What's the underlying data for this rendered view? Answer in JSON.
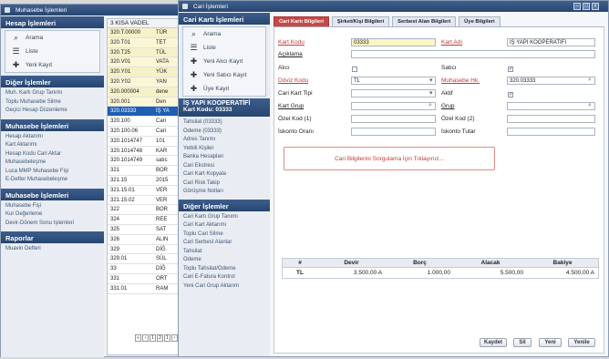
{
  "back_window": {
    "title": "Muhasebe İşlemleri"
  },
  "left_sidebar": {
    "hesap_title": "Hesap İşlemleri",
    "hesap_items": [
      "Arama",
      "Liste",
      "Yeni Kayıt"
    ],
    "diger_title": "Diğer İşlemler",
    "diger_items": [
      "Muh. Kartı Grup Tanımı",
      "Toplu Muhasebe Silme",
      "Geçici Hesap Düzenleme"
    ],
    "muh_title": "Muhasebe İşlemleri",
    "muh_items": [
      "Hesap Aktarımı",
      "Kart Aktarımı",
      "Hesap Kodu Cari Aktar",
      "Muhasebeleşme",
      "Luca MMP Muhasebe Fişi",
      "E-Defter Muhasebeleşme"
    ],
    "fis_title": "Muhasebe İşlemleri",
    "fis_items": [
      "Muhasebe Fişi",
      "Kur Değerleme",
      "Devir-Dönem Sonu İşlemleri"
    ],
    "rapor_title": "Raporlar",
    "rapor_items": [
      "Muavin Defteri"
    ]
  },
  "account_list": {
    "header": "3 KISA VADEL",
    "rows": [
      {
        "code": "320.T.00000",
        "name": "TÜR"
      },
      {
        "code": "320.T01",
        "name": "TET"
      },
      {
        "code": "320.T25",
        "name": "TÜL"
      },
      {
        "code": "320.V01",
        "name": "VATA"
      },
      {
        "code": "320.Y01",
        "name": "YÜK"
      },
      {
        "code": "320.Y02",
        "name": "YAN"
      },
      {
        "code": "320.000004",
        "name": "dene"
      },
      {
        "code": "320.001",
        "name": "Den"
      },
      {
        "code": "320.03333",
        "name": "İŞ YA"
      },
      {
        "code": "320.100",
        "name": "Cari"
      },
      {
        "code": "320.100.06",
        "name": "Cari"
      },
      {
        "code": "320.1014747",
        "name": "101"
      },
      {
        "code": "320.1014748",
        "name": "KAR"
      },
      {
        "code": "320.1014749",
        "name": "satıc"
      },
      {
        "code": "321",
        "name": "BOR"
      },
      {
        "code": "321.15",
        "name": "2015"
      },
      {
        "code": "321.15.01",
        "name": "VER"
      },
      {
        "code": "321.15.02",
        "name": "VER"
      },
      {
        "code": "322",
        "name": "BOR"
      },
      {
        "code": "324",
        "name": "REE"
      },
      {
        "code": "325",
        "name": "SAT"
      },
      {
        "code": "326",
        "name": "ALIN"
      },
      {
        "code": "329",
        "name": "DİĞ"
      },
      {
        "code": "329.01",
        "name": "SÜL"
      },
      {
        "code": "33",
        "name": "DİĞ"
      },
      {
        "code": "331",
        "name": "ORT"
      },
      {
        "code": "331.01",
        "name": "RAM"
      }
    ],
    "pager": [
      "«",
      "‹",
      "1",
      "2",
      "1",
      "›"
    ]
  },
  "front_window": {
    "title": "Cari İşlemleri"
  },
  "cari_sidebar": {
    "title": "Cari Kartı İşlemleri",
    "items": [
      "Arama",
      "Liste",
      "Yeni Alıcı Kayıt",
      "Yeni Satıcı Kayıt",
      "Üye Kayıt"
    ],
    "company_title": "İŞ YAPI KOOPERATİFİ",
    "company_code": "Kart Kodu: 03333",
    "company_links": [
      "Tahsilat (03333)",
      "Ödeme (03333)",
      "Adres Tanımı",
      "Yetkili Kişiler",
      "Banka Hesapları",
      "Cari Ekstresi",
      "Cari Kart Kopyala",
      "Cari Risk Takip",
      "Görüşme Notları"
    ],
    "diger_title": "Diğer İşlemler",
    "diger_links": [
      "Cari Kartı Grup Tanımı",
      "Cari Kart Aktarımı",
      "Toplu Cari Silme",
      "Cari Serbest Alanlar",
      "Tahsilat",
      "Ödeme",
      "Toplu Tahsilat/Ödeme",
      "Cari E-Fatura Kontrol",
      "Yeni Cari Grup Aktarım"
    ]
  },
  "tabs": [
    "Cari Kartı Bilgileri",
    "Şirket/Kişi Bilgileri",
    "Serbest Alan Bilgileri",
    "Üye Bilgileri"
  ],
  "form": {
    "kart_kodu_label": "Kart Kodu",
    "kart_kodu_value": "03333",
    "kart_adi_label": "Kart Adı",
    "kart_adi_value": "İŞ YAPI KOOPERATİFİ",
    "aciklama_label": "Açıklama",
    "alici_label": "Alıcı",
    "satici_label": "Satıcı",
    "doviz_label": "Döviz Kodu",
    "doviz_value": "TL",
    "muhasebe_label": "Muhasebe Hk.",
    "muhasebe_value": "320.03333",
    "tip_label": "Cari Kart Tipi",
    "aktif_label": "Aktif",
    "kart_grup_label": "Kart Grup",
    "grup_label": "Grup",
    "ozel1_label": "Özel Kod (1)",
    "ozel2_label": "Özel Kod (2)",
    "iskonto_label": "İskonto Oranı",
    "iskonto_tutar_label": "İskonto Tutar",
    "sorgula_text": "Cari Bilgilerini Sorgulama İçin Tıklayınız..."
  },
  "summary": {
    "headers": [
      "#",
      "Devir",
      "Borç",
      "Alacak",
      "Bakiye"
    ],
    "row": [
      "TL",
      "3.500,00 A",
      "1.000,00",
      "5.500,00",
      "4.500,00 A"
    ]
  },
  "buttons": {
    "save": "Kaydet",
    "delete": "Sil",
    "new": "Yeni",
    "refresh": "Yenile"
  }
}
